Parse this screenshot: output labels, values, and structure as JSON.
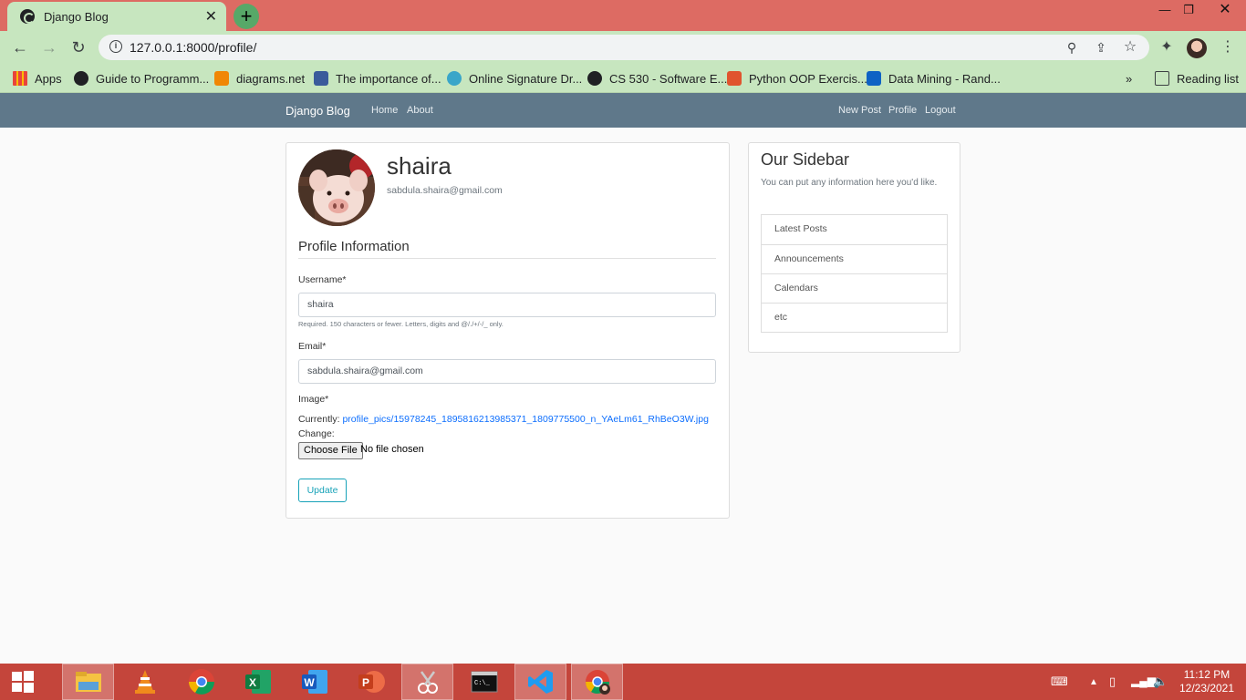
{
  "browser": {
    "tab_title": "Django Blog",
    "url": "127.0.0.1:8000/profile/",
    "bookmarks": [
      {
        "label": "Apps",
        "color": "#e8453c"
      },
      {
        "label": "Guide to Programm...",
        "color": "#202124"
      },
      {
        "label": "diagrams.net",
        "color": "#f08705"
      },
      {
        "label": "The importance of...",
        "color": "#3a5b9b"
      },
      {
        "label": "Online Signature Dr...",
        "color": "#3aa6c9"
      },
      {
        "label": "CS 530 - Software E...",
        "color": "#202124"
      },
      {
        "label": "Python OOP Exercis...",
        "color": "#e0542e"
      },
      {
        "label": "Data Mining - Rand...",
        "color": "#0e62c4"
      }
    ],
    "reading_list": "Reading list",
    "more_bookmarks": "»"
  },
  "site": {
    "brand": "Django Blog",
    "nav_left": [
      "Home",
      "About"
    ],
    "nav_right": [
      "New Post",
      "Profile",
      "Logout"
    ]
  },
  "profile": {
    "username": "shaira",
    "email": "sabdula.shaira@gmail.com",
    "legend": "Profile Information",
    "form": {
      "username_label": "Username*",
      "username_value": "shaira",
      "username_help": "Required. 150 characters or fewer. Letters, digits and @/./+/-/_ only.",
      "email_label": "Email*",
      "email_value": "sabdula.shaira@gmail.com",
      "image_label": "Image*",
      "currently_label": "Currently:",
      "current_image": "profile_pics/15978245_1895816213985371_1809775500_n_YAeLm61_RhBeO3W.jpg",
      "change_label": "Change:",
      "choose_file": "Choose File",
      "no_file": "No file chosen",
      "update_button": "Update"
    }
  },
  "sidebar": {
    "title": "Our Sidebar",
    "text": "You can put any information here you'd like.",
    "items": [
      "Latest Posts",
      "Announcements",
      "Calendars",
      "etc"
    ]
  },
  "taskbar": {
    "time": "11:12 PM",
    "date": "12/23/2021"
  }
}
